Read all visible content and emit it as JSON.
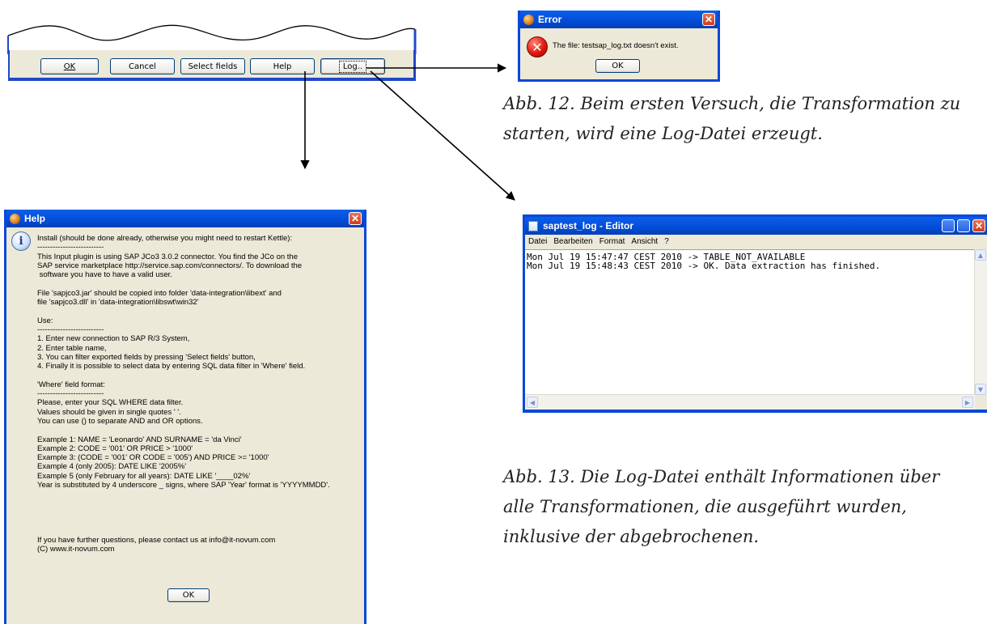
{
  "button_bar": {
    "ok": "OK",
    "cancel": "Cancel",
    "select_fields": "Select fields",
    "help": "Help",
    "log": "Log.."
  },
  "error_dialog": {
    "title": "Error",
    "message": "The file: testsap_log.txt doesn't exist.",
    "ok": "OK",
    "icon": "error-icon"
  },
  "caption_12": {
    "line1": "Abb. 12. Beim ersten Versuch, die Transformation zu",
    "line2": "starten, wird eine Log-Datei erzeugt."
  },
  "notepad": {
    "title": "saptest_log - Editor",
    "menu": [
      "Datei",
      "Bearbeiten",
      "Format",
      "Ansicht",
      "?"
    ],
    "lines": [
      "Mon Jul 19 15:47:47 CEST 2010 -> TABLE_NOT_AVAILABLE",
      "Mon Jul 19 15:48:43 CEST 2010 -> OK. Data extraction has finished."
    ]
  },
  "caption_13": {
    "line1": "Abb. 13. Die Log-Datei enthält Informationen über",
    "line2": "alle Transformationen, die ausgeführt wurden,",
    "line3": "inklusive der abgebrochenen."
  },
  "help_dialog": {
    "title": "Help",
    "ok": "OK",
    "lines": [
      "Install (should be done already, otherwise you might need to restart Kettle):",
      "--------------------------",
      "This Input plugin is using SAP JCo3 3.0.2 connector. You find the JCo on the",
      "SAP service marketplace http://service.sap.com/connectors/. To download the",
      " software you have to have a valid user.",
      "",
      "File 'sapjco3.jar' should be copied into folder 'data-integration\\libext' and",
      "file 'sapjco3.dll' in 'data-integration\\libswt\\win32'",
      "",
      "Use:",
      "--------------------------",
      "1. Enter new connection to SAP R/3 System,",
      "2. Enter table name,",
      "3. You can filter exported fields by pressing 'Select fields' button,",
      "4. Finally it is possible to select data by entering SQL data filter in 'Where' field.",
      "",
      "'Where' field format:",
      "--------------------------",
      "Please, enter your SQL WHERE data filter.",
      "Values should be given in single quotes ' '.",
      "You can use () to separate AND and OR options.",
      "",
      "Example 1: NAME = 'Leonardo' AND SURNAME = 'da Vinci'",
      "Example 2: CODE = '001' OR PRICE > '1000'",
      "Example 3: (CODE = '001' OR CODE = '005') AND PRICE >= '1000'",
      "Example 4 (only 2005): DATE LIKE '2005%'",
      "Example 5 (only February for all years): DATE LIKE '____02%'",
      "Year is substituted by 4 underscore _ signs, where SAP 'Year' format is 'YYYYMMDD'.",
      "",
      "",
      "",
      "",
      "",
      "If you have further questions, please contact us at info@it-novum.com",
      "(C) www.it-novum.com"
    ]
  }
}
